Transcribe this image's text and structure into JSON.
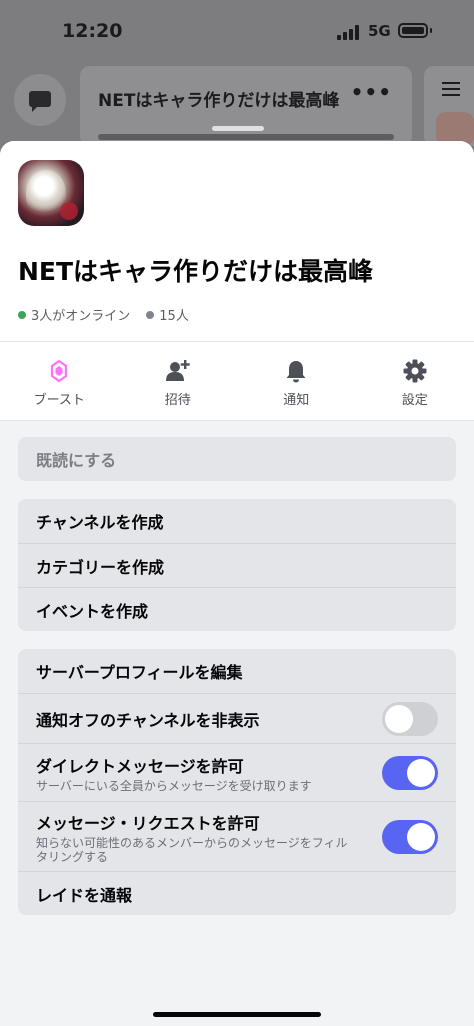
{
  "status_bar": {
    "time": "12:20",
    "network": "5G"
  },
  "background": {
    "channel_title": "NETはキャラ作りだけは最高峰",
    "more_label": "•••"
  },
  "server": {
    "name": "NETはキャラ作りだけは最高峰",
    "online_text": "3人がオンライン",
    "members_text": "15人"
  },
  "actions": [
    {
      "label": "ブースト",
      "icon": "boost-icon",
      "color": "#ff73fa"
    },
    {
      "label": "招待",
      "icon": "add-user-icon"
    },
    {
      "label": "通知",
      "icon": "bell-icon"
    },
    {
      "label": "設定",
      "icon": "gear-icon"
    }
  ],
  "panel1": {
    "mark_read": "既読にする"
  },
  "panel2": {
    "create_channel": "チャンネルを作成",
    "create_category": "カテゴリーを作成",
    "create_event": "イベントを作成"
  },
  "panel3": {
    "edit_profile": "サーバープロフィールを編集",
    "hide_muted": {
      "label": "通知オフのチャンネルを非表示",
      "enabled": false
    },
    "allow_dm": {
      "label": "ダイレクトメッセージを許可",
      "sub": "サーバーにいる全員からメッセージを受け取ります",
      "enabled": true
    },
    "allow_requests": {
      "label": "メッセージ・リクエストを許可",
      "sub": "知らない可能性のあるメンバーからのメッセージをフィルタリングする",
      "enabled": true
    },
    "report_raid": "レイドを通報"
  },
  "colors": {
    "accent": "#5865f2",
    "online": "#3ba55c",
    "boost": "#ff73fa"
  }
}
